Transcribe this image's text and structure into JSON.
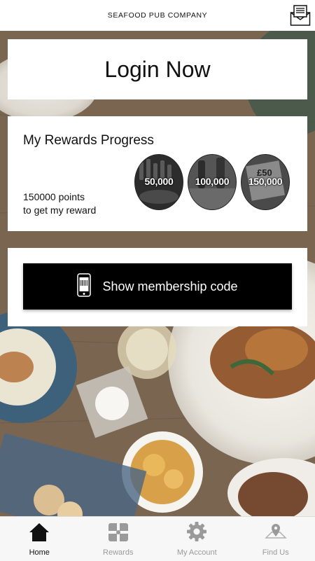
{
  "header": {
    "brand": "SEAFOOD PUB COMPANY",
    "mail_icon": "envelope-icon"
  },
  "login": {
    "label": "Login Now"
  },
  "rewards": {
    "title": "My Rewards Progress",
    "points_line1": "150000 points",
    "points_line2": "to get my reward",
    "badges": [
      {
        "label": "50,000"
      },
      {
        "label": "100,000"
      },
      {
        "label": "150,000"
      }
    ]
  },
  "membership": {
    "label": "Show membership code",
    "icon": "phone-barcode-icon"
  },
  "tabs": [
    {
      "label": "Home",
      "icon": "home-icon",
      "active": true
    },
    {
      "label": "Rewards",
      "icon": "gift-icon",
      "active": false
    },
    {
      "label": "My Account",
      "icon": "gear-icon",
      "active": false
    },
    {
      "label": "Find Us",
      "icon": "map-pin-icon",
      "active": false
    }
  ],
  "colors": {
    "accent": "#000000",
    "inactive_tab": "#9a9a9a"
  }
}
